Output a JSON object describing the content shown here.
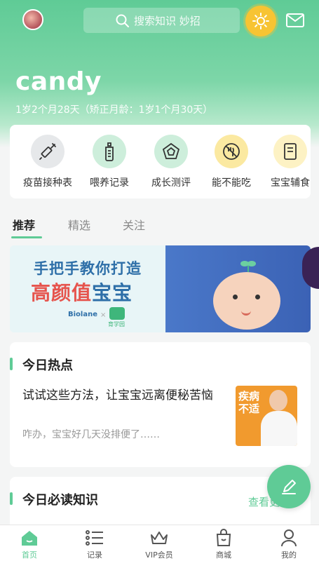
{
  "header": {
    "search_placeholder": "搜索知识 妙招",
    "username": "candy",
    "age_text": "1岁2个月28天（矫正月龄：1岁1个月30天）"
  },
  "quick_actions": [
    {
      "label": "疫苗接种表",
      "icon": "syringe-icon",
      "bg": "#e6e8ea"
    },
    {
      "label": "喂养记录",
      "icon": "bottle-icon",
      "bg": "#cdeedb"
    },
    {
      "label": "成长测评",
      "icon": "pentagon-icon",
      "bg": "#cdeedb"
    },
    {
      "label": "能不能吃",
      "icon": "no-food-icon",
      "bg": "#fbe9a1"
    },
    {
      "label": "宝宝辅食",
      "icon": "book-icon",
      "bg": "#fdf2c4"
    }
  ],
  "tabs": [
    {
      "label": "推荐",
      "active": true
    },
    {
      "label": "精选",
      "active": false
    },
    {
      "label": "关注",
      "active": false
    }
  ],
  "banner": {
    "line1": "手把手教你打造",
    "line2_red": "高颜值",
    "line2_blue": "宝宝",
    "brand1": "Biolane",
    "brand_sep": "×",
    "brand2": "育学园"
  },
  "hot_section": {
    "title": "今日热点",
    "article_title": "试试这些方法，让宝宝远离便秘苦恼",
    "article_summary": "咋办，宝宝好几天没排便了……",
    "image_text": "疾病不适"
  },
  "must_read": {
    "title": "今日必读知识",
    "view_all": "查看更多"
  },
  "bottom_nav": [
    {
      "label": "首页",
      "icon": "home-icon",
      "active": true
    },
    {
      "label": "记录",
      "icon": "list-icon",
      "active": false
    },
    {
      "label": "VIP会员",
      "icon": "crown-icon",
      "active": false
    },
    {
      "label": "商城",
      "icon": "shopping-bag-icon",
      "active": false
    },
    {
      "label": "我的",
      "icon": "user-icon",
      "active": false
    }
  ],
  "colors": {
    "accent": "#5fcb96",
    "sun": "#f7c433"
  }
}
